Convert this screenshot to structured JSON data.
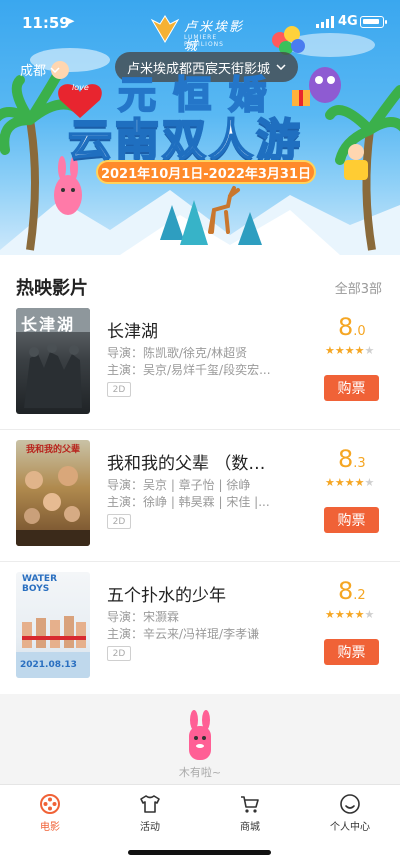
{
  "status_bar": {
    "time": "11:59",
    "network": "4G"
  },
  "brand": {
    "name": "卢米埃影城",
    "subtitle": "LUMIERE PAVILIONS"
  },
  "header": {
    "city": "成都",
    "cinema": "卢米埃成都西宸天街影城"
  },
  "banner": {
    "title_line1": "元 恒 婚",
    "title_line2": "云南双人游",
    "date_range": "2021年10月1日-2022年3月31日",
    "badge": "love"
  },
  "section": {
    "title": "热映影片",
    "all_label": "全部3部"
  },
  "movies": [
    {
      "title": "长津湖",
      "director": "导演：陈凯歌/徐克/林超贤",
      "cast": "主演：吴京/易烊千玺/段奕宏...",
      "format": "2D",
      "score_int": "8",
      "score_dec": ".0",
      "rating_stars": 4,
      "buy_label": "购票",
      "poster_text": "长津湖"
    },
    {
      "title": "我和我的父辈 （数…",
      "director": "导演：吴京 | 章子怡 | 徐峥",
      "cast": "主演：徐峥 | 韩昊霖 | 宋佳 |...",
      "format": "2D",
      "score_int": "8",
      "score_dec": ".3",
      "rating_stars": 4,
      "buy_label": "购票",
      "poster_text": "我和我的父辈"
    },
    {
      "title": "五个扑水的少年",
      "director": "导演：宋灏霖",
      "cast": "主演：辛云来/冯祥琨/李孝谦",
      "format": "2D",
      "score_int": "8",
      "score_dec": ".2",
      "rating_stars": 4,
      "buy_label": "购票",
      "poster_text": "WATER BOYS",
      "poster_date": "2021.08.13"
    }
  ],
  "empty": {
    "text": "木有啦~"
  },
  "tabs": [
    {
      "label": "电影",
      "icon": "film-reel-icon",
      "active": true
    },
    {
      "label": "活动",
      "icon": "tshirt-icon",
      "active": false
    },
    {
      "label": "商城",
      "icon": "cart-icon",
      "active": false
    },
    {
      "label": "个人中心",
      "icon": "smiley-user-icon",
      "active": false
    }
  ],
  "colors": {
    "accent": "#f06237",
    "star": "#f5a623",
    "banner_sky": "#3aa7ef"
  }
}
